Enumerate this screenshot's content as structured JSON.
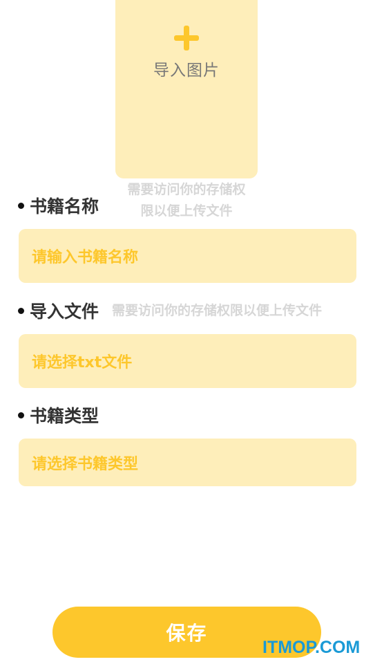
{
  "cover": {
    "icon": "plus-icon",
    "label": "导入图片",
    "hint_line1": "需要访问你的存储权",
    "hint_line2": "限以便上传文件"
  },
  "book_name": {
    "label": "书籍名称",
    "placeholder": "请输入书籍名称"
  },
  "import_file": {
    "label": "导入文件",
    "hint": "需要访问你的存储权限以便上传文件",
    "placeholder": "请选择txt文件"
  },
  "book_type": {
    "label": "书籍类型",
    "placeholder": "请选择书籍类型"
  },
  "save_button": {
    "label": "保存"
  },
  "watermark": "ITMOP.COM",
  "colors": {
    "accent": "#fdc72c",
    "field_background": "#feeeba",
    "hint_text": "#d6d6d6",
    "label_text": "#333333"
  }
}
